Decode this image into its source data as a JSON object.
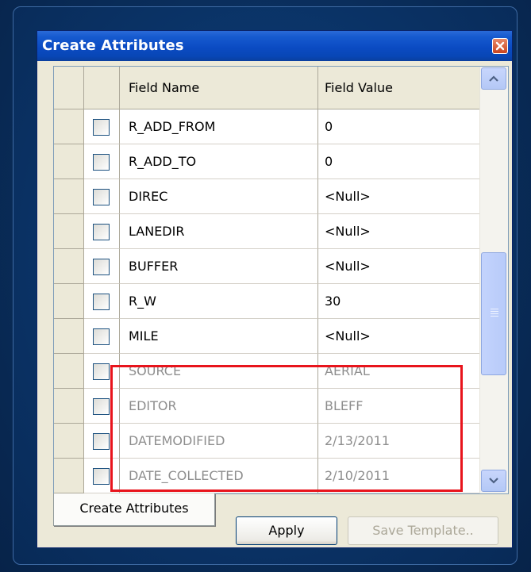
{
  "window": {
    "title": "Create Attributes"
  },
  "grid": {
    "headers": {
      "field_name": "Field Name",
      "field_value": "Field Value"
    },
    "rows": [
      {
        "name": "R_ADD_FROM",
        "value": "0",
        "state": "normal"
      },
      {
        "name": "R_ADD_TO",
        "value": "0",
        "state": "normal"
      },
      {
        "name": "DIREC",
        "value": "<Null>",
        "state": "normal"
      },
      {
        "name": "LANEDIR",
        "value": "<Null>",
        "state": "normal"
      },
      {
        "name": "BUFFER",
        "value": "<Null>",
        "state": "normal"
      },
      {
        "name": "R_W",
        "value": "30",
        "state": "normal"
      },
      {
        "name": "MILE",
        "value": "<Null>",
        "state": "normal"
      },
      {
        "name": "SOURCE",
        "value": "AERIAL",
        "state": "disabled"
      },
      {
        "name": "EDITOR",
        "value": "BLEFF",
        "state": "disabled"
      },
      {
        "name": "DATEMODIFIED",
        "value": "2/13/2011",
        "state": "disabled"
      },
      {
        "name": "DATE_COLLECTED",
        "value": "2/10/2011",
        "state": "disabled"
      }
    ]
  },
  "tabs": [
    {
      "label": "Create Attributes"
    }
  ],
  "buttons": {
    "apply": "Apply",
    "save_template": "Save Template.."
  },
  "icons": {
    "close": "close-icon",
    "scroll_up": "chevron-up-icon",
    "scroll_down": "chevron-down-icon"
  },
  "colors": {
    "highlight": "#e8141c",
    "titlebar": "#0b4bc3",
    "disabled_text": "#8e8e8e"
  }
}
